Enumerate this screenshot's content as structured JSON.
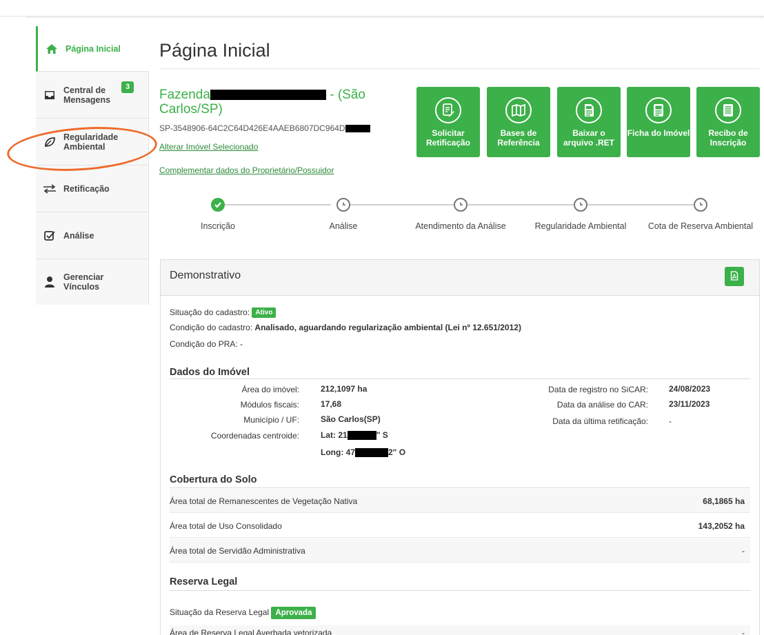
{
  "sidebar": {
    "items": [
      {
        "label": "Página Inicial"
      },
      {
        "label": "Central de Mensagens",
        "badge": "3"
      },
      {
        "label": "Regularidade Ambiental"
      },
      {
        "label": "Retificação"
      },
      {
        "label": "Análise"
      },
      {
        "label": "Gerenciar Vínculos"
      }
    ]
  },
  "page": {
    "title": "Página Inicial"
  },
  "property": {
    "name_prefix": "Fazenda",
    "name_suffix": "- (São Carlos/SP)",
    "code": "SP-3548906-64C2C64D426E4AAEB6807DC964D",
    "link_change": "Alterar Imóvel Selecionado",
    "link_complement": "Complementar dados do Proprietário/Possuidor"
  },
  "actions": [
    {
      "label": "Solicitar Retificação",
      "icon": "edit-document-icon"
    },
    {
      "label": "Bases de Referência",
      "icon": "map-icon"
    },
    {
      "label": "Baixar o arquivo .RET",
      "icon": "ret-file-icon"
    },
    {
      "label": "Ficha do Imóvel",
      "icon": "id-card-icon"
    },
    {
      "label": "Recibo de Inscrição",
      "icon": "receipt-icon"
    }
  ],
  "steps": [
    {
      "label": "Inscrição",
      "status": "done"
    },
    {
      "label": "Análise",
      "status": "pending"
    },
    {
      "label": "Atendimento da Análise",
      "status": "pending"
    },
    {
      "label": "Regularidade Ambiental",
      "status": "pending"
    },
    {
      "label": "Cota de Reserva Ambiental",
      "status": "pending"
    }
  ],
  "demonstrativo": {
    "title": "Demonstrativo",
    "situacao_label": "Situação do cadastro:",
    "situacao_value": "Ativo",
    "condicao_label": "Condição do cadastro:",
    "condicao_value": "Analisado, aguardando regularização ambiental (Lei nº 12.651/2012)",
    "pra_label": "Condição do PRA:",
    "pra_value": "-"
  },
  "dados": {
    "title": "Dados do Imóvel",
    "area_label": "Área do imóvel:",
    "area_value": "212,1097 ha",
    "modulos_label": "Módulos fiscais:",
    "modulos_value": "17,68",
    "municipio_label": "Município / UF:",
    "municipio_value": "São Carlos(SP)",
    "coord_label": "Coordenadas centroide:",
    "lat_prefix": "Lat: 21",
    "lat_suffix": "\" S",
    "long_prefix": "Long: 47",
    "long_suffix": "2\" O",
    "registro_label": "Data de registro no SiCAR:",
    "registro_value": "24/08/2023",
    "analise_label": "Data da análise do CAR:",
    "analise_value": "23/11/2023",
    "retificacao_label": "Data da última retificação:",
    "retificacao_value": "-"
  },
  "cobertura": {
    "title": "Cobertura do Solo",
    "rows": [
      {
        "label": "Área total de Remanescentes de Vegetação Nativa",
        "value": "68,1865 ha"
      },
      {
        "label": "Área total de Uso Consolidado",
        "value": "143,2052 ha"
      },
      {
        "label": "Área total de Servidão Administrativa",
        "value": "-"
      }
    ]
  },
  "reserva": {
    "title": "Reserva Legal",
    "situacao_label": "Situação da Reserva Legal",
    "situacao_value": "Aprovada",
    "row_label": "Área de Reserva Legal Averbada vetorizada",
    "row_value": "-"
  },
  "colors": {
    "accent": "#3cb049",
    "annotation": "#ee6a2a"
  }
}
